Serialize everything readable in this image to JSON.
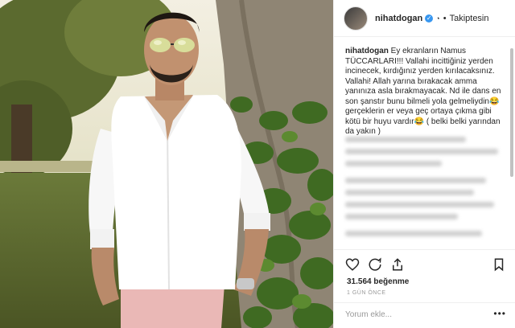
{
  "post": {
    "username": "nihatdogan",
    "follow_label": "Takiptesin",
    "caption_username": "nihatdogan",
    "caption_text": "Ey ekranların Namus TÜCCARLARI!!! Vallahi incittiğiniz yerden incinecek, kırdığınız yerden kırılacaksınız. Vallahi! Allah yarına bırakacak amma yanınıza asla bırakmayacak. Nd ile dans en son şanstır bunu bilmeli yola gelmeliydin😂 gerçeklerin er veya geç ortaya çıkma gibi kötü bir huyu vardır😂 ( belki belki yarından da yakın )",
    "likes": "31.564 beğenme",
    "time": "1 GÜN ÖNCE",
    "comment_placeholder": "Yorum ekle...",
    "more_label": "•••"
  },
  "icons": [
    "heart-icon",
    "comment-icon",
    "share-icon",
    "bookmark-icon",
    "verified-icon"
  ],
  "colors": {
    "verified": "#3897f0",
    "text": "#262626",
    "muted": "#999999"
  }
}
